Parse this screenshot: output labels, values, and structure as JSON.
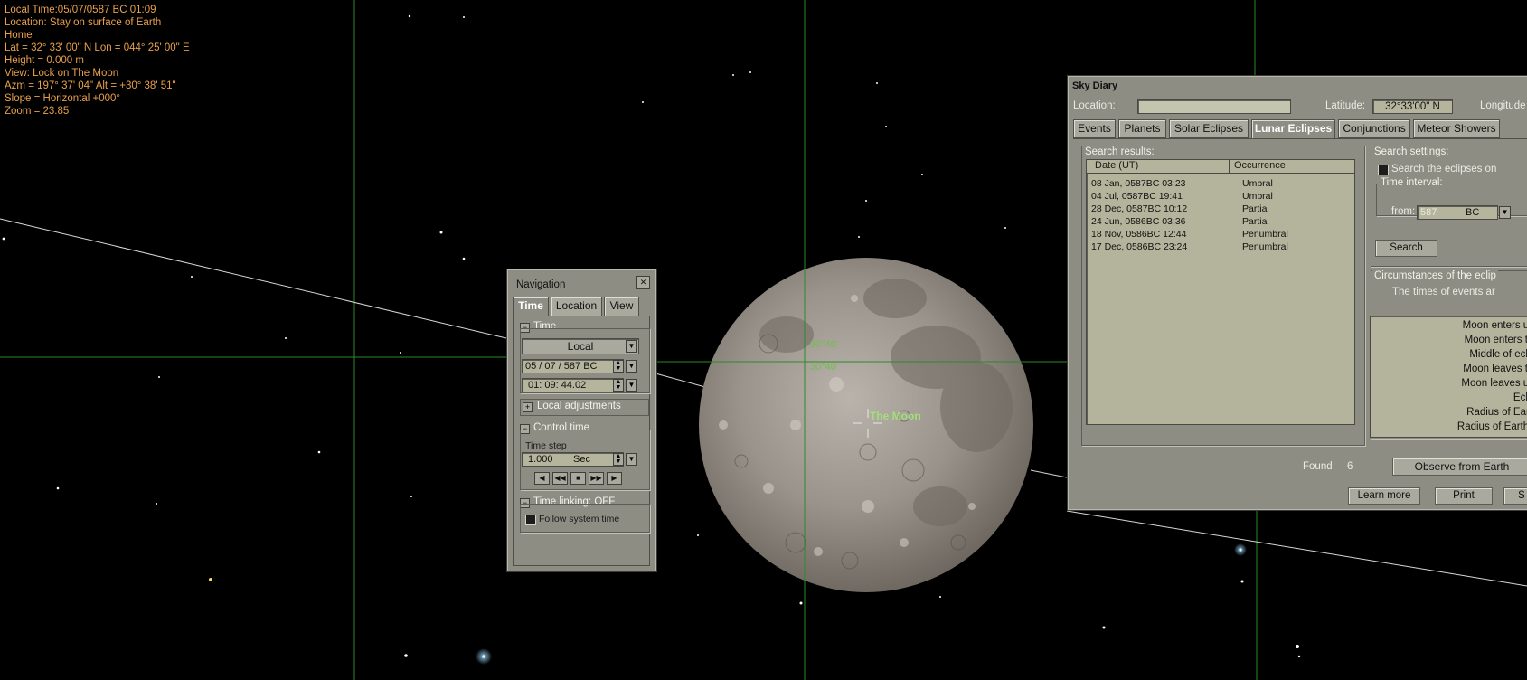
{
  "hud": {
    "local_time": "Local Time:05/07/0587 BC 01:09",
    "location": "Location: Stay on surface of Earth",
    "home": "Home",
    "latlon": "Lat = 32° 33' 00\" N   Lon = 044° 25' 00\" E",
    "height": "Height = 0.000 m",
    "view": "View: Lock on The Moon",
    "azm_alt": "Azm = 197° 37' 04\"  Alt = +30° 38' 51\"",
    "slope": "Slope = Horizontal +000°",
    "zoom": "Zoom = 23.85"
  },
  "sky": {
    "moon_label": "The Moon",
    "grid_label_1": "30°40'",
    "grid_label_2": "30°40'"
  },
  "navigation": {
    "title": "Navigation",
    "close_glyph": "✕",
    "tabs": [
      "Time",
      "Location",
      "View"
    ],
    "active_tab": "Time",
    "time_section": "Time",
    "time_mode": "Local",
    "date_value": "05 / 07 /  587   BC",
    "time_value": "01:  09: 44.02",
    "local_adjustments": "Local adjustments",
    "control_time": "Control time",
    "time_step_label": "Time step",
    "time_step_value": "1.000",
    "time_step_unit": "Sec",
    "time_linking": "Time linking: OFF",
    "follow_system_time": "Follow system time"
  },
  "sky_diary": {
    "title": "Sky Diary",
    "location_label": "Location:",
    "location_value": "",
    "latitude_label": "Latitude:",
    "latitude_value": "32°33'00\" N",
    "longitude_label": "Longitude",
    "tabs": [
      "Events",
      "Planets",
      "Solar Eclipses",
      "Lunar Eclipses",
      "Conjunctions",
      "Meteor Showers"
    ],
    "active_tab": "Lunar Eclipses",
    "search_results_label": "Search results:",
    "columns": [
      "Date (UT)",
      "Occurrence"
    ],
    "results": [
      {
        "date": "08 Jan, 0587BC 03:23",
        "occurrence": "Umbral"
      },
      {
        "date": "04 Jul, 0587BC 19:41",
        "occurrence": "Umbral"
      },
      {
        "date": "28 Dec, 0587BC 10:12",
        "occurrence": "Partial"
      },
      {
        "date": "24 Jun, 0586BC 03:36",
        "occurrence": "Partial"
      },
      {
        "date": "18 Nov, 0586BC 12:44",
        "occurrence": "Penumbral"
      },
      {
        "date": "17 Dec, 0586BC 23:24",
        "occurrence": "Penumbral"
      }
    ],
    "found_label": "Found",
    "found_count": "6",
    "search_settings_label": "Search settings:",
    "search_eclipses_option": "Search the eclipses on",
    "time_interval_label": "Time interval:",
    "from_label": "from:",
    "from_value": "587",
    "from_era": "BC",
    "search_button": "Search",
    "circumstances_label": "Circumstances of the eclip",
    "times_note": "The times of events ar",
    "circumstances": [
      "Moon enters umbr",
      "Moon enters totali",
      "Middle of eclipse",
      "Moon leaves totali",
      "Moon leaves umbr",
      "Eclipse",
      "Radius of Earth u",
      "Radius of Earth per"
    ],
    "observe_button": "Observe from Earth",
    "learn_more_button": "Learn more",
    "print_button": "Print",
    "cutoff_button": "S"
  },
  "colors": {
    "hud_text": "#e8a04a",
    "panel": "#8d8d84",
    "grid_line": "#2a8a2a",
    "moon_label": "#9fe07a"
  }
}
